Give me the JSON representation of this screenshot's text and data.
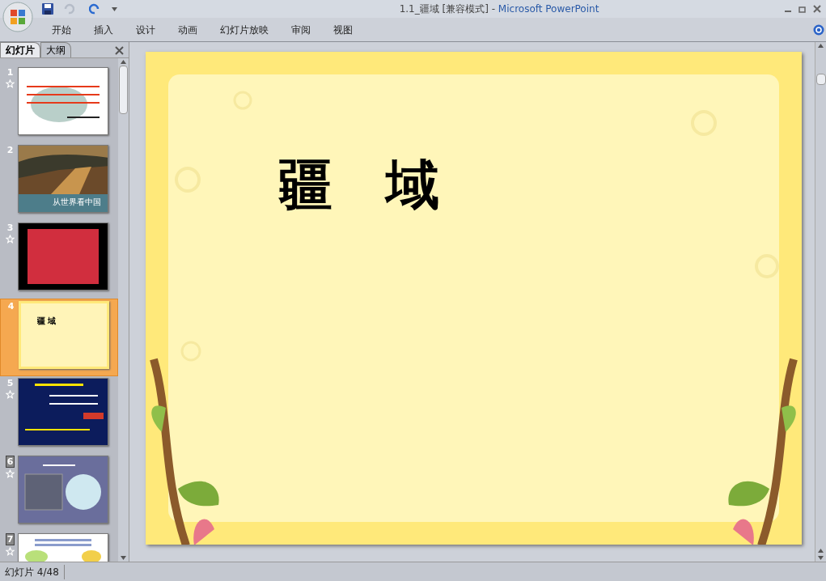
{
  "window": {
    "document": "1.1_疆域 [兼容模式] - ",
    "app": "Microsoft PowerPoint"
  },
  "ribbon_tabs": [
    {
      "label": "开始",
      "selected": false
    },
    {
      "label": "插入",
      "selected": false
    },
    {
      "label": "设计",
      "selected": false
    },
    {
      "label": "动画",
      "selected": false
    },
    {
      "label": "幻灯片放映",
      "selected": false
    },
    {
      "label": "审阅",
      "selected": false
    },
    {
      "label": "视图",
      "selected": false
    }
  ],
  "pane_tabs": [
    {
      "label": "幻灯片",
      "selected": true
    },
    {
      "label": "大纲",
      "selected": false
    }
  ],
  "slides": [
    {
      "number": "1",
      "animated": true,
      "hidden": false,
      "selected": false,
      "kind": "riddle"
    },
    {
      "number": "2",
      "animated": false,
      "hidden": false,
      "selected": false,
      "caption": "从世界看中国"
    },
    {
      "number": "3",
      "animated": true,
      "hidden": false,
      "selected": false,
      "kind": "red"
    },
    {
      "number": "4",
      "animated": false,
      "hidden": false,
      "selected": true,
      "kind": "title",
      "caption": "疆 域"
    },
    {
      "number": "5",
      "animated": true,
      "hidden": false,
      "selected": false,
      "kind": "navy"
    },
    {
      "number": "6",
      "animated": true,
      "hidden": true,
      "selected": false,
      "kind": "globe"
    },
    {
      "number": "7",
      "animated": true,
      "hidden": true,
      "selected": false,
      "kind": "maps"
    }
  ],
  "slide": {
    "title": "疆　域"
  },
  "status_bar": {
    "position": "幻灯片 4/48"
  }
}
